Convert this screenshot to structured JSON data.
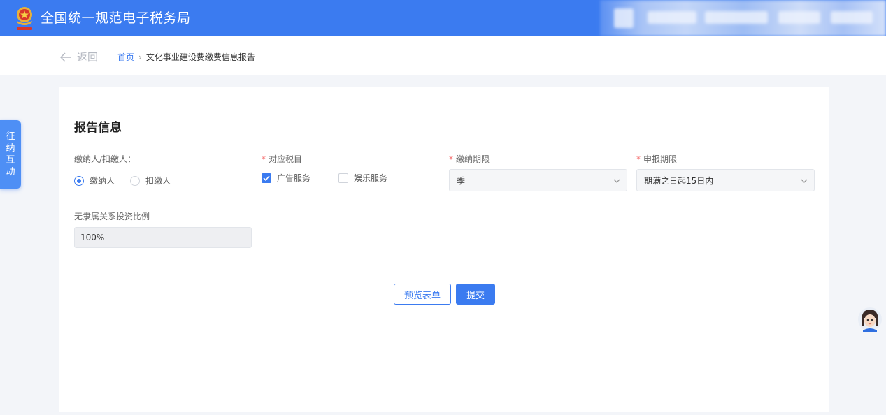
{
  "header": {
    "title": "全国统一规范电子税务局",
    "logo_icon": "tax-emblem-icon",
    "brand_color": "#3b7bf0"
  },
  "breadcrumb": {
    "back_label": "返回",
    "home_label": "首页",
    "separator": "›",
    "current": "文化事业建设费缴费信息报告"
  },
  "side_tab": {
    "chars": [
      "征",
      "纳",
      "互",
      "动"
    ]
  },
  "form": {
    "section_title": "报告信息",
    "payer": {
      "label": "缴纳人/扣缴人：",
      "options": [
        {
          "label": "缴纳人",
          "selected": true
        },
        {
          "label": "扣缴人",
          "selected": false
        }
      ]
    },
    "tax_item": {
      "required_mark": "*",
      "label": "对应税目",
      "options": [
        {
          "label": "广告服务",
          "checked": true
        },
        {
          "label": "娱乐服务",
          "checked": false
        }
      ]
    },
    "pay_period": {
      "required_mark": "*",
      "label": "缴纳期限",
      "value": "季"
    },
    "declare_period": {
      "required_mark": "*",
      "label": "申报期限",
      "value": "期满之日起15日内"
    },
    "investment_ratio": {
      "label": "无隶属关系投资比例",
      "value": "100%"
    }
  },
  "actions": {
    "preview_label": "预览表单",
    "submit_label": "提交"
  },
  "colors": {
    "accent": "#3b7bf0",
    "required": "#f56c6c",
    "page_bg": "#f3f5f9"
  }
}
